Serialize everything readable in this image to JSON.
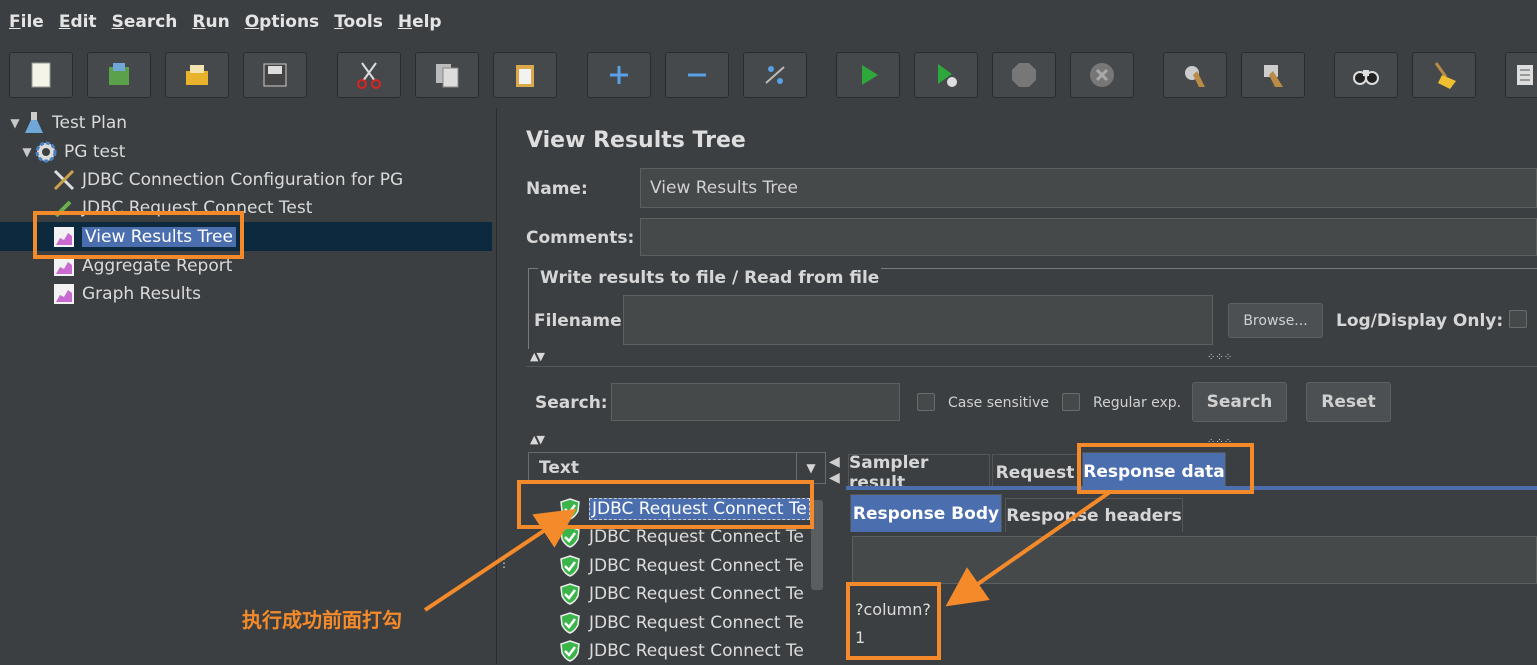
{
  "menu": [
    "File",
    "Edit",
    "Search",
    "Run",
    "Options",
    "Tools",
    "Help"
  ],
  "toolbar": {
    "icons": [
      "new-icon",
      "templates-icon",
      "open-icon",
      "save-icon",
      "cut-icon",
      "copy-icon",
      "paste-icon",
      "expand-icon",
      "collapse-icon",
      "toggle-icon",
      "start-icon",
      "start-no-pauses-icon",
      "stop-icon",
      "shutdown-icon",
      "clear-icon",
      "clear-all-icon",
      "search-icon",
      "reset-search-icon",
      "function-helper-icon"
    ]
  },
  "tree": {
    "items": [
      {
        "label": "Test Plan"
      },
      {
        "label": "PG test"
      },
      {
        "label": "JDBC Connection Configuration for PG"
      },
      {
        "label": "JDBC Request Connect Test"
      },
      {
        "label": "View Results Tree"
      },
      {
        "label": "Aggregate Report"
      },
      {
        "label": "Graph Results"
      }
    ]
  },
  "panel": {
    "title": "View Results Tree",
    "name_label": "Name:",
    "name_value": "View Results Tree",
    "comments_label": "Comments:",
    "comments_value": "",
    "group_title": "Write results to file / Read from file",
    "filename_label": "Filename",
    "filename_value": "",
    "browse_label": "Browse...",
    "log_display_label": "Log/Display Only:",
    "search_label": "Search:",
    "search_value": "",
    "case_sensitive_label": "Case sensitive",
    "regular_exp_label": "Regular exp.",
    "search_button": "Search",
    "reset_button": "Reset"
  },
  "results": {
    "column_header": "Text",
    "rows": [
      "JDBC Request Connect Te",
      "JDBC Request Connect Te",
      "JDBC Request Connect Te",
      "JDBC Request Connect Te",
      "JDBC Request Connect Te",
      "JDBC Request Connect Te"
    ]
  },
  "tabs": {
    "main": [
      "Sampler result",
      "Request",
      "Response data"
    ],
    "sub": [
      "Response Body",
      "Response headers"
    ]
  },
  "response": {
    "line1": "?column?",
    "line2": "1"
  },
  "annotation": {
    "note": "执行成功前面打勾"
  },
  "colors": {
    "accent": "#4b6eaf",
    "annotation": "#f58a2a",
    "background": "#3c3f41",
    "success": "#3bb54a"
  }
}
